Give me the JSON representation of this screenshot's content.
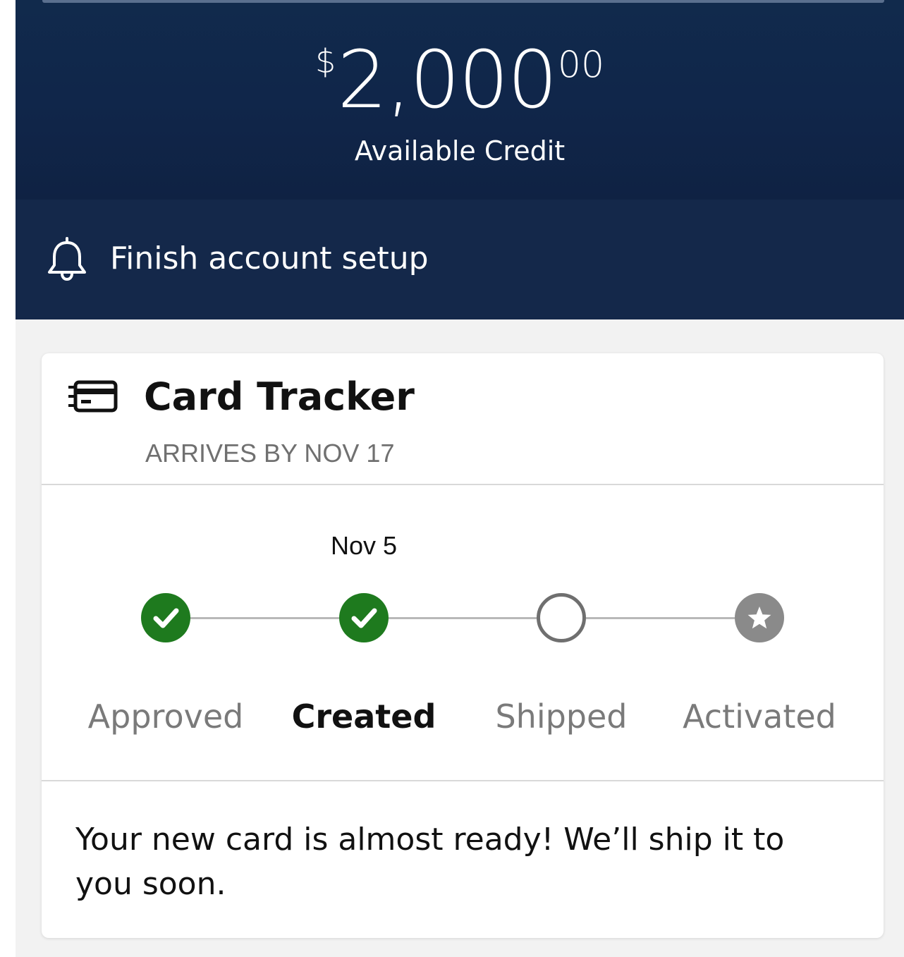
{
  "hero": {
    "currency_symbol": "$",
    "amount_whole": "2,000",
    "amount_cents": "00",
    "label": "Available Credit"
  },
  "alert": {
    "icon": "bell-icon",
    "label": "Finish account setup"
  },
  "card_tracker": {
    "icon": "credit-card-icon",
    "title": "Card Tracker",
    "subtitle": "ARRIVES BY NOV 17",
    "steps": [
      {
        "label": "Approved",
        "date": "",
        "status": "complete",
        "icon": "check-icon"
      },
      {
        "label": "Created",
        "date": "Nov 5",
        "status": "current",
        "icon": "check-icon"
      },
      {
        "label": "Shipped",
        "date": "",
        "status": "pending",
        "icon": "empty-circle-icon"
      },
      {
        "label": "Activated",
        "date": "",
        "status": "locked",
        "icon": "star-icon"
      }
    ],
    "message": "Your new card is almost ready! We’ll ship it to you soon."
  },
  "colors": {
    "hero_background": "#10264a",
    "alert_background": "#14284a",
    "complete_green": "#1e7a1e",
    "pending_gray": "#6f6f6f",
    "locked_gray": "#8a8a8a",
    "page_background": "#f2f2f2"
  }
}
